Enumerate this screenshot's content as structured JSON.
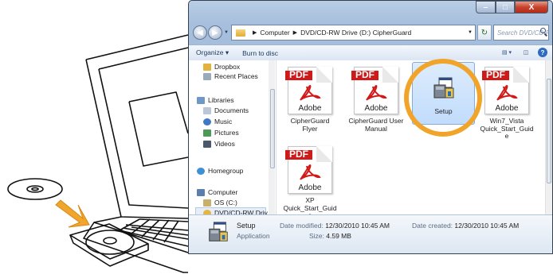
{
  "window": {
    "address": [
      "Computer",
      "DVD/CD-RW Drive (D:) CipherGuard"
    ],
    "search_placeholder": "Search DVD/CD-RW Dr...",
    "caption_buttons": {
      "minimize": "–",
      "maximize": "□",
      "close": "X"
    }
  },
  "toolbar": {
    "organize": "Organize ▾",
    "burn": "Burn to disc"
  },
  "sidebar": {
    "items": [
      {
        "label": "Dropbox",
        "icon": "dropbox-icon",
        "color": "#e3b23c"
      },
      {
        "label": "Recent Places",
        "icon": "recent-places-icon",
        "color": "#9aa9bb"
      },
      {
        "label": "Libraries",
        "icon": "libraries-icon",
        "color": "#6f97c7"
      },
      {
        "label": "Documents",
        "icon": "documents-icon",
        "color": "#b9c7d8"
      },
      {
        "label": "Music",
        "icon": "music-icon",
        "color": "#3f78c6"
      },
      {
        "label": "Pictures",
        "icon": "pictures-icon",
        "color": "#4b9a58"
      },
      {
        "label": "Videos",
        "icon": "videos-icon",
        "color": "#48596c"
      },
      {
        "label": "Homegroup",
        "icon": "homegroup-icon",
        "color": "#3d8fd6"
      },
      {
        "label": "Computer",
        "icon": "computer-icon",
        "color": "#5a7fae"
      },
      {
        "label": "OS (C:)",
        "icon": "drive-c-icon",
        "color": "#c8b06a"
      },
      {
        "label": "DVD/CD-RW Driv",
        "icon": "dvd-drive-icon",
        "color": "#e4b540"
      }
    ]
  },
  "files": [
    {
      "name": "CipherGuard Flyer",
      "line1": "CipherGuard",
      "line2": "Flyer",
      "line3": "",
      "type": "pdf"
    },
    {
      "name": "CipherGuard User Manual",
      "line1": "CipherGuard User",
      "line2": "Manual",
      "line3": "",
      "type": "pdf"
    },
    {
      "name": "Setup",
      "line1": "Setup",
      "line2": "",
      "line3": "",
      "type": "exe"
    },
    {
      "name": "Win7_Vista Quick_Start_Guide",
      "line1": "Win7_Vista",
      "line2": "Quick_Start_Guid",
      "line3": "e",
      "type": "pdf"
    },
    {
      "name": "XP Quick_Start_Guide",
      "line1": "XP",
      "line2": "Quick_Start_Guid",
      "line3": "e",
      "type": "pdf"
    }
  ],
  "pdf_badge": "PDF",
  "pdf_brand": "Adobe",
  "details": {
    "name": "Setup",
    "type": "Application",
    "modified_label": "Date modified:",
    "modified_value": "12/30/2010 10:45 AM",
    "size_label": "Size:",
    "size_value": "4.59 MB",
    "created_label": "Date created:",
    "created_value": "12/30/2010 10:45 AM"
  },
  "colors": {
    "highlight_circle": "#f1a42a",
    "arrow": "#f0a52d",
    "pdf_red": "#d01a1a"
  }
}
